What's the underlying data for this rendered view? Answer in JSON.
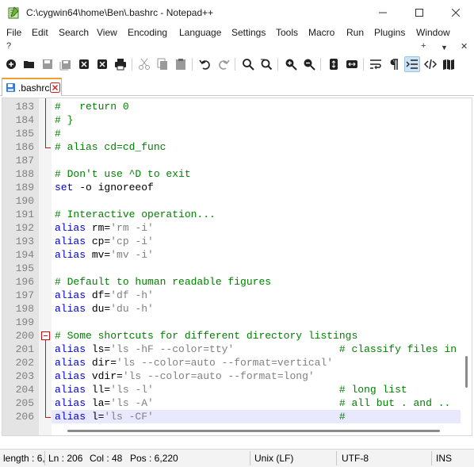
{
  "window": {
    "title": "C:\\cygwin64\\home\\Ben\\.bashrc - Notepad++"
  },
  "menu": {
    "items": [
      "File",
      "Edit",
      "Search",
      "View",
      "Encoding",
      "Language",
      "Settings",
      "Tools",
      "Macro",
      "Run",
      "Plugins",
      "Window",
      "?"
    ],
    "right_add": "+",
    "right_dropdown": "▼",
    "right_close": "✕"
  },
  "toolbar": {
    "icons": [
      "new-file-icon",
      "open-folder-icon",
      "save-icon",
      "save-all-icon",
      "close-icon",
      "close-all-icon",
      "print-icon",
      "cut-icon",
      "copy-icon",
      "paste-icon",
      "undo-icon",
      "redo-icon",
      "find-icon",
      "replace-icon",
      "zoom-in-icon",
      "zoom-out-icon",
      "sync-vertical-icon",
      "sync-horizontal-icon",
      "word-wrap-icon",
      "show-all-characters-icon",
      "indent-guide-icon",
      "xml-tag-icon",
      "document-map-icon"
    ]
  },
  "tab": {
    "label": ".bashrc"
  },
  "editor": {
    "lines": [
      {
        "num": "183",
        "tokens": [
          {
            "t": "#   return 0",
            "c": "comment"
          }
        ]
      },
      {
        "num": "184",
        "tokens": [
          {
            "t": "# }",
            "c": "comment"
          }
        ]
      },
      {
        "num": "185",
        "tokens": [
          {
            "t": "#",
            "c": "comment"
          }
        ]
      },
      {
        "num": "186",
        "tokens": [
          {
            "t": "# alias cd=cd_func",
            "c": "comment"
          }
        ]
      },
      {
        "num": "187",
        "tokens": []
      },
      {
        "num": "188",
        "tokens": [
          {
            "t": "# Don't use ^D to exit",
            "c": "comment"
          }
        ]
      },
      {
        "num": "189",
        "tokens": [
          {
            "t": "set",
            "c": "keyword"
          },
          {
            "t": " -o ignoreeof",
            "c": "plain"
          }
        ]
      },
      {
        "num": "190",
        "tokens": []
      },
      {
        "num": "191",
        "tokens": [
          {
            "t": "# Interactive operation...",
            "c": "comment"
          }
        ]
      },
      {
        "num": "192",
        "tokens": [
          {
            "t": "alias",
            "c": "keyword"
          },
          {
            "t": " rm=",
            "c": "plain"
          },
          {
            "t": "'rm -i'",
            "c": "string"
          }
        ]
      },
      {
        "num": "193",
        "tokens": [
          {
            "t": "alias",
            "c": "keyword"
          },
          {
            "t": " cp=",
            "c": "plain"
          },
          {
            "t": "'cp -i'",
            "c": "string"
          }
        ]
      },
      {
        "num": "194",
        "tokens": [
          {
            "t": "alias",
            "c": "keyword"
          },
          {
            "t": " mv=",
            "c": "plain"
          },
          {
            "t": "'mv -i'",
            "c": "string"
          }
        ]
      },
      {
        "num": "195",
        "tokens": []
      },
      {
        "num": "196",
        "tokens": [
          {
            "t": "# Default to human readable figures",
            "c": "comment"
          }
        ]
      },
      {
        "num": "197",
        "tokens": [
          {
            "t": "alias",
            "c": "keyword"
          },
          {
            "t": " df=",
            "c": "plain"
          },
          {
            "t": "'df -h'",
            "c": "string"
          }
        ]
      },
      {
        "num": "198",
        "tokens": [
          {
            "t": "alias",
            "c": "keyword"
          },
          {
            "t": " du=",
            "c": "plain"
          },
          {
            "t": "'du -h'",
            "c": "string"
          }
        ]
      },
      {
        "num": "199",
        "tokens": []
      },
      {
        "num": "200",
        "tokens": [
          {
            "t": "# Some shortcuts for different directory listings",
            "c": "comment"
          }
        ]
      },
      {
        "num": "201",
        "tokens": [
          {
            "t": "alias",
            "c": "keyword"
          },
          {
            "t": " ls=",
            "c": "plain"
          },
          {
            "t": "'ls -hF --color=tty'",
            "c": "string"
          },
          {
            "t": "                 # classify files in",
            "c": "comment"
          }
        ]
      },
      {
        "num": "202",
        "tokens": [
          {
            "t": "alias",
            "c": "keyword"
          },
          {
            "t": " dir=",
            "c": "plain"
          },
          {
            "t": "'ls --color=auto --format=vertical'",
            "c": "string"
          }
        ]
      },
      {
        "num": "203",
        "tokens": [
          {
            "t": "alias",
            "c": "keyword"
          },
          {
            "t": " vdir=",
            "c": "plain"
          },
          {
            "t": "'ls --color=auto --format=long'",
            "c": "string"
          }
        ]
      },
      {
        "num": "204",
        "tokens": [
          {
            "t": "alias",
            "c": "keyword"
          },
          {
            "t": " ll=",
            "c": "plain"
          },
          {
            "t": "'ls -l'",
            "c": "string"
          },
          {
            "t": "                              # long list",
            "c": "comment"
          }
        ]
      },
      {
        "num": "205",
        "tokens": [
          {
            "t": "alias",
            "c": "keyword"
          },
          {
            "t": " la=",
            "c": "plain"
          },
          {
            "t": "'ls -A'",
            "c": "string"
          },
          {
            "t": "                              # all but . and ..",
            "c": "comment"
          }
        ]
      },
      {
        "num": "206",
        "tokens": [
          {
            "t": "alias",
            "c": "keyword"
          },
          {
            "t": " l=",
            "c": "plain"
          },
          {
            "t": "'ls -CF'",
            "c": "string"
          },
          {
            "t": "                              #",
            "c": "comment"
          }
        ]
      }
    ]
  },
  "status": {
    "length": "length : 6,",
    "ln": "Ln : 206",
    "col": "Col : 48",
    "pos": "Pos : 6,220",
    "eol": "Unix (LF)",
    "encoding": "UTF-8",
    "mode": "INS"
  }
}
